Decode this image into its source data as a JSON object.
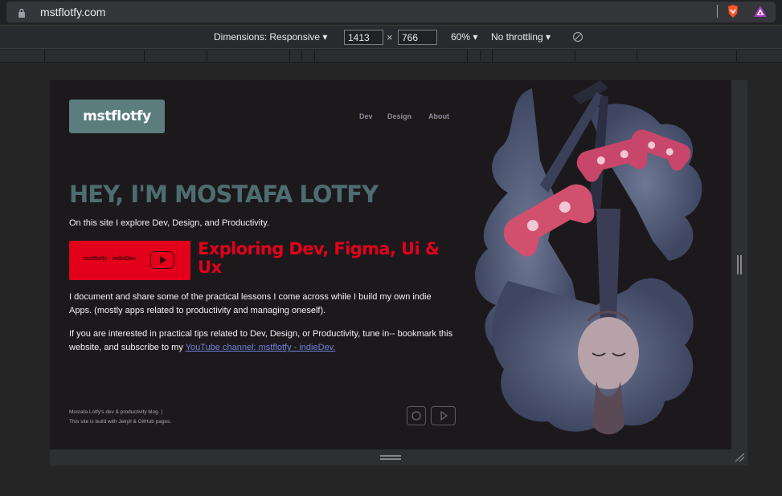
{
  "browser": {
    "url": "mstflotfy.com",
    "lock_icon": "lock-icon",
    "extensions": [
      "brave-shield-icon",
      "triangle-extension-icon"
    ]
  },
  "devtools": {
    "dimensions_label": "Dimensions: Responsive",
    "width": "1413",
    "height": "766",
    "times": "×",
    "zoom": "60%",
    "throttling": "No throttling",
    "rotate_icon": "rotate-icon"
  },
  "site": {
    "logo": "mstflotfy",
    "nav": [
      "Dev",
      "Design",
      "About"
    ],
    "headline": "HEY, I'M MOSTAFA LOTFY",
    "intro": "On this site I explore Dev, Design, and Productivity.",
    "youtube_card": {
      "label": "mstflotfy - indieDev",
      "icon": "play-icon"
    },
    "youtube_title": "Exploring Dev, Figma, Ui & Ux",
    "paragraph1": "I document and share some of the practical lessons I come across while I build my own indie Apps. (mostly apps related to productivity and managing oneself).",
    "paragraph2_prefix": "If you are interested in practical tips related to Dev, Design, or Productivity, tune in-- bookmark this website, and subscribe to my ",
    "paragraph2_link": "YouTube channel: mstflotfy - indieDev.",
    "footer_line1": "Mostafa Lotfy's dev & productivity blog. |",
    "footer_line2": "This site is build with Jekyll & GitHub pages.",
    "social_icons": [
      "instagram-icon",
      "youtube-icon"
    ]
  },
  "colors": {
    "logo_bg": "#5b7d7e",
    "headline": "#4d6d70",
    "accent_red": "#e3001b",
    "link": "#6f82d6",
    "page_bg": "#1c191c"
  }
}
